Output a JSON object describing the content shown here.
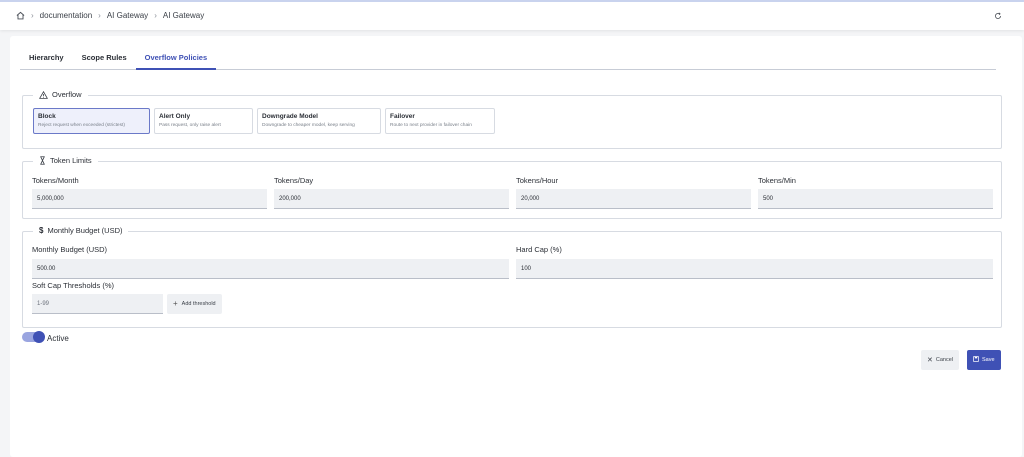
{
  "breadcrumb": {
    "items": [
      "documentation",
      "AI Gateway",
      "AI Gateway"
    ]
  },
  "tabs": [
    {
      "label": "Hierarchy",
      "active": false
    },
    {
      "label": "Scope Rules",
      "active": false
    },
    {
      "label": "Overflow Policies",
      "active": true
    }
  ],
  "overflow": {
    "legend": "Overflow",
    "options": [
      {
        "title": "Block",
        "desc": "Reject request when exceeded (strictest)",
        "selected": true
      },
      {
        "title": "Alert Only",
        "desc": "Pass request, only raise alert",
        "selected": false
      },
      {
        "title": "Downgrade Model",
        "desc": "Downgrade to cheaper model, keep serving",
        "selected": false
      },
      {
        "title": "Failover",
        "desc": "Route to next provider in failover chain",
        "selected": false
      }
    ]
  },
  "token_limits": {
    "legend": "Token Limits",
    "fields": [
      {
        "label": "Tokens/Month",
        "value": "5,000,000"
      },
      {
        "label": "Tokens/Day",
        "value": "200,000"
      },
      {
        "label": "Tokens/Hour",
        "value": "20,000"
      },
      {
        "label": "Tokens/Min",
        "value": "500"
      }
    ]
  },
  "budget": {
    "legend": "Monthly Budget (USD)",
    "monthly_label": "Monthly Budget (USD)",
    "monthly_value": "500.00",
    "hardcap_label": "Hard Cap (%)",
    "hardcap_value": "100",
    "softcap_label": "Soft Cap Thresholds (%)",
    "softcap_placeholder": "1-99",
    "add_threshold_label": "Add threshold"
  },
  "active": {
    "label": "Active",
    "on": true
  },
  "actions": {
    "cancel_label": "Cancel",
    "save_label": "Save"
  },
  "colors": {
    "accent": "#3f51b5",
    "field_bg": "#eef0f3"
  },
  "icons": [
    "home-icon",
    "chevron-right-icon",
    "refresh-icon",
    "warning-icon",
    "hourglass-icon",
    "dollar-icon",
    "plus-icon",
    "close-icon",
    "save-icon"
  ]
}
